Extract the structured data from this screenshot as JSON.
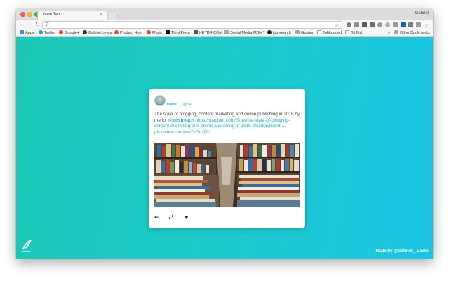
{
  "browser": {
    "tab_title": "New Tab",
    "tab_close": "×",
    "profile_name": "Gabriel",
    "omnibox_value": "",
    "back_icon": "←",
    "forward_icon": "→",
    "reload_icon": "↻",
    "star_icon": "☆",
    "menu_icon": "⋮",
    "search_icon": "⚲",
    "extension_icons": [
      "shield-icon",
      "camera-icon",
      "bookmark-icon",
      "cast-icon",
      "sync-icon",
      "circle-icon",
      "tag-icon",
      "linkedin-icon",
      "translate-icon",
      "grid-icon",
      "list-icon",
      "pocket-icon",
      "window-icon",
      "stack-icon"
    ]
  },
  "bookmarks": {
    "items": [
      {
        "label": "Apps",
        "color": "#4285f4"
      },
      {
        "label": "Twitter",
        "color": "#1da1f2"
      },
      {
        "label": "Google+",
        "color": "#dd4b39"
      },
      {
        "label": "Gabriel Lewis",
        "color": "#333333"
      },
      {
        "label": "Product Hunt",
        "color": "#da552f"
      },
      {
        "label": "Music",
        "color": "#e0502e"
      },
      {
        "label": "ThinkPiece",
        "color": "#111111"
      },
      {
        "label": "KEYBR.COM",
        "color": "#555555"
      },
      {
        "label": "Social Media MGMT",
        "color": "#9a9a9a"
      },
      {
        "label": "job-search",
        "color": "#222222"
      },
      {
        "label": "Guides",
        "color": "#9a9a9a"
      },
      {
        "label": "JobLogged",
        "color": "#bbbbbb"
      },
      {
        "label": "Bit Fish",
        "color": "#bbbbbb"
      }
    ],
    "overflow": "»",
    "other_bookmarks": "Other Bookmarks"
  },
  "tweet": {
    "author_name": "Owen",
    "separator": "›",
    "author_handle": "@ow",
    "text_before": "The state of blogging, content marketing and online publishing in 2016 by me for ",
    "mention": "@postreach",
    "text_link": " https://medium.com/@ow/the-state-of-blogging-content-marketing-and-online-publishing-in-2016-2fc160c35dcd …pic.twitter.com/iwa7sGczZfc",
    "actions": {
      "reply": "↩",
      "retweet": "⇄",
      "like": "♥"
    }
  },
  "footer": {
    "made_by": "Made by @Gabriel__Lewis"
  },
  "colors": {
    "accent": "#1ab6b9",
    "gradient_start": "#1cc7b6",
    "gradient_end": "#1bc5e6"
  }
}
